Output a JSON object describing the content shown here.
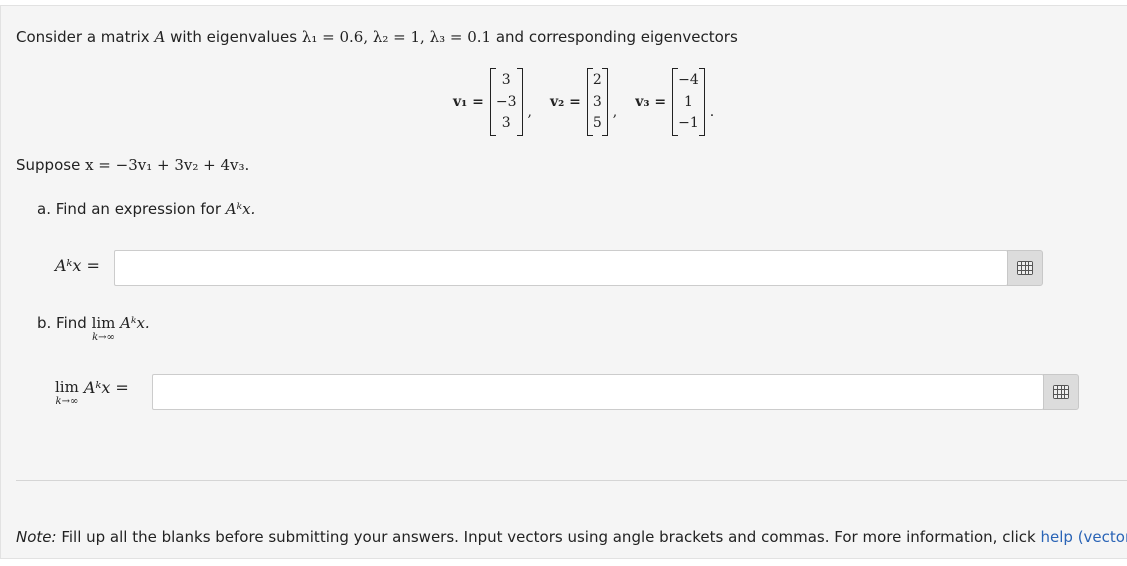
{
  "intro": {
    "prefix": "Consider a matrix ",
    "matrix_symbol": "A",
    "middle": " with eigenvalues ",
    "eigenvalues": "λ₁ = 0.6, λ₂ = 1, λ₃ = 0.1",
    "suffix": " and corresponding eigenvectors"
  },
  "vectors": [
    {
      "label": "v₁ =",
      "entries": [
        "3",
        "−3",
        "3"
      ],
      "sep": ","
    },
    {
      "label": "v₂ =",
      "entries": [
        "2",
        "3",
        "5"
      ],
      "sep": ","
    },
    {
      "label": "v₃ =",
      "entries": [
        "−4",
        "1",
        "−1"
      ],
      "sep": "."
    }
  ],
  "suppose": {
    "prefix": "Suppose ",
    "expression": "x = −3v₁ + 3v₂ + 4v₃."
  },
  "part_a": {
    "question_prefix": "a. Find an expression for ",
    "question_math": "Aᵏx.",
    "answer_label": "Aᵏx =",
    "input_value": "",
    "input_placeholder": ""
  },
  "part_b": {
    "question_prefix": "b. Find ",
    "lim": "lim",
    "lim_sub": "k→∞",
    "question_math": "Aᵏx.",
    "answer_lim": "lim",
    "answer_lim_sub": "k→∞",
    "answer_math": "Aᵏx =",
    "input_value": "",
    "input_placeholder": ""
  },
  "note": {
    "label": "Note:",
    "text": " Fill up all the blanks before submitting your answers. Input vectors using angle brackets and commas. For more information, click ",
    "link": "help (vectors)",
    "end": "."
  },
  "icons": {
    "keyboard_button": "keyboard-icon"
  },
  "colors": {
    "panel_bg": "#f5f5f5",
    "link": "#2a64b6"
  }
}
